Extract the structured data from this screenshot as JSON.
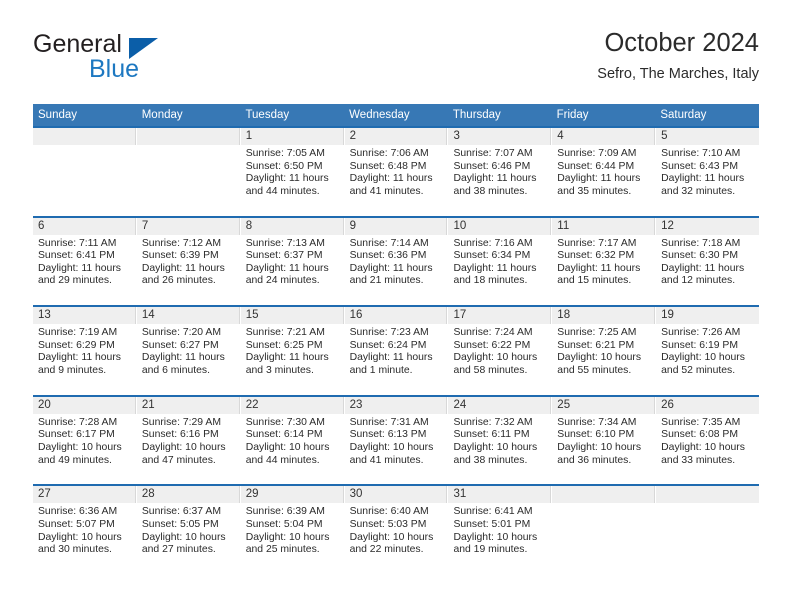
{
  "brand": {
    "name_part1": "General",
    "name_part2": "Blue",
    "triangle_color": "#0b5ea8",
    "blue_color": "#1d78c1"
  },
  "header": {
    "title": "October 2024",
    "subtitle": "Sefro, The Marches, Italy"
  },
  "theme": {
    "header_band": "#3778b5",
    "row_divider": "#1f6bb0",
    "date_strip": "#efefef"
  },
  "weekdays": [
    "Sunday",
    "Monday",
    "Tuesday",
    "Wednesday",
    "Thursday",
    "Friday",
    "Saturday"
  ],
  "weeks": [
    [
      {
        "day": "",
        "sunrise": "",
        "sunset": "",
        "daylight1": "",
        "daylight2": ""
      },
      {
        "day": "",
        "sunrise": "",
        "sunset": "",
        "daylight1": "",
        "daylight2": ""
      },
      {
        "day": "1",
        "sunrise": "Sunrise: 7:05 AM",
        "sunset": "Sunset: 6:50 PM",
        "daylight1": "Daylight: 11 hours",
        "daylight2": "and 44 minutes."
      },
      {
        "day": "2",
        "sunrise": "Sunrise: 7:06 AM",
        "sunset": "Sunset: 6:48 PM",
        "daylight1": "Daylight: 11 hours",
        "daylight2": "and 41 minutes."
      },
      {
        "day": "3",
        "sunrise": "Sunrise: 7:07 AM",
        "sunset": "Sunset: 6:46 PM",
        "daylight1": "Daylight: 11 hours",
        "daylight2": "and 38 minutes."
      },
      {
        "day": "4",
        "sunrise": "Sunrise: 7:09 AM",
        "sunset": "Sunset: 6:44 PM",
        "daylight1": "Daylight: 11 hours",
        "daylight2": "and 35 minutes."
      },
      {
        "day": "5",
        "sunrise": "Sunrise: 7:10 AM",
        "sunset": "Sunset: 6:43 PM",
        "daylight1": "Daylight: 11 hours",
        "daylight2": "and 32 minutes."
      }
    ],
    [
      {
        "day": "6",
        "sunrise": "Sunrise: 7:11 AM",
        "sunset": "Sunset: 6:41 PM",
        "daylight1": "Daylight: 11 hours",
        "daylight2": "and 29 minutes."
      },
      {
        "day": "7",
        "sunrise": "Sunrise: 7:12 AM",
        "sunset": "Sunset: 6:39 PM",
        "daylight1": "Daylight: 11 hours",
        "daylight2": "and 26 minutes."
      },
      {
        "day": "8",
        "sunrise": "Sunrise: 7:13 AM",
        "sunset": "Sunset: 6:37 PM",
        "daylight1": "Daylight: 11 hours",
        "daylight2": "and 24 minutes."
      },
      {
        "day": "9",
        "sunrise": "Sunrise: 7:14 AM",
        "sunset": "Sunset: 6:36 PM",
        "daylight1": "Daylight: 11 hours",
        "daylight2": "and 21 minutes."
      },
      {
        "day": "10",
        "sunrise": "Sunrise: 7:16 AM",
        "sunset": "Sunset: 6:34 PM",
        "daylight1": "Daylight: 11 hours",
        "daylight2": "and 18 minutes."
      },
      {
        "day": "11",
        "sunrise": "Sunrise: 7:17 AM",
        "sunset": "Sunset: 6:32 PM",
        "daylight1": "Daylight: 11 hours",
        "daylight2": "and 15 minutes."
      },
      {
        "day": "12",
        "sunrise": "Sunrise: 7:18 AM",
        "sunset": "Sunset: 6:30 PM",
        "daylight1": "Daylight: 11 hours",
        "daylight2": "and 12 minutes."
      }
    ],
    [
      {
        "day": "13",
        "sunrise": "Sunrise: 7:19 AM",
        "sunset": "Sunset: 6:29 PM",
        "daylight1": "Daylight: 11 hours",
        "daylight2": "and 9 minutes."
      },
      {
        "day": "14",
        "sunrise": "Sunrise: 7:20 AM",
        "sunset": "Sunset: 6:27 PM",
        "daylight1": "Daylight: 11 hours",
        "daylight2": "and 6 minutes."
      },
      {
        "day": "15",
        "sunrise": "Sunrise: 7:21 AM",
        "sunset": "Sunset: 6:25 PM",
        "daylight1": "Daylight: 11 hours",
        "daylight2": "and 3 minutes."
      },
      {
        "day": "16",
        "sunrise": "Sunrise: 7:23 AM",
        "sunset": "Sunset: 6:24 PM",
        "daylight1": "Daylight: 11 hours",
        "daylight2": "and 1 minute."
      },
      {
        "day": "17",
        "sunrise": "Sunrise: 7:24 AM",
        "sunset": "Sunset: 6:22 PM",
        "daylight1": "Daylight: 10 hours",
        "daylight2": "and 58 minutes."
      },
      {
        "day": "18",
        "sunrise": "Sunrise: 7:25 AM",
        "sunset": "Sunset: 6:21 PM",
        "daylight1": "Daylight: 10 hours",
        "daylight2": "and 55 minutes."
      },
      {
        "day": "19",
        "sunrise": "Sunrise: 7:26 AM",
        "sunset": "Sunset: 6:19 PM",
        "daylight1": "Daylight: 10 hours",
        "daylight2": "and 52 minutes."
      }
    ],
    [
      {
        "day": "20",
        "sunrise": "Sunrise: 7:28 AM",
        "sunset": "Sunset: 6:17 PM",
        "daylight1": "Daylight: 10 hours",
        "daylight2": "and 49 minutes."
      },
      {
        "day": "21",
        "sunrise": "Sunrise: 7:29 AM",
        "sunset": "Sunset: 6:16 PM",
        "daylight1": "Daylight: 10 hours",
        "daylight2": "and 47 minutes."
      },
      {
        "day": "22",
        "sunrise": "Sunrise: 7:30 AM",
        "sunset": "Sunset: 6:14 PM",
        "daylight1": "Daylight: 10 hours",
        "daylight2": "and 44 minutes."
      },
      {
        "day": "23",
        "sunrise": "Sunrise: 7:31 AM",
        "sunset": "Sunset: 6:13 PM",
        "daylight1": "Daylight: 10 hours",
        "daylight2": "and 41 minutes."
      },
      {
        "day": "24",
        "sunrise": "Sunrise: 7:32 AM",
        "sunset": "Sunset: 6:11 PM",
        "daylight1": "Daylight: 10 hours",
        "daylight2": "and 38 minutes."
      },
      {
        "day": "25",
        "sunrise": "Sunrise: 7:34 AM",
        "sunset": "Sunset: 6:10 PM",
        "daylight1": "Daylight: 10 hours",
        "daylight2": "and 36 minutes."
      },
      {
        "day": "26",
        "sunrise": "Sunrise: 7:35 AM",
        "sunset": "Sunset: 6:08 PM",
        "daylight1": "Daylight: 10 hours",
        "daylight2": "and 33 minutes."
      }
    ],
    [
      {
        "day": "27",
        "sunrise": "Sunrise: 6:36 AM",
        "sunset": "Sunset: 5:07 PM",
        "daylight1": "Daylight: 10 hours",
        "daylight2": "and 30 minutes."
      },
      {
        "day": "28",
        "sunrise": "Sunrise: 6:37 AM",
        "sunset": "Sunset: 5:05 PM",
        "daylight1": "Daylight: 10 hours",
        "daylight2": "and 27 minutes."
      },
      {
        "day": "29",
        "sunrise": "Sunrise: 6:39 AM",
        "sunset": "Sunset: 5:04 PM",
        "daylight1": "Daylight: 10 hours",
        "daylight2": "and 25 minutes."
      },
      {
        "day": "30",
        "sunrise": "Sunrise: 6:40 AM",
        "sunset": "Sunset: 5:03 PM",
        "daylight1": "Daylight: 10 hours",
        "daylight2": "and 22 minutes."
      },
      {
        "day": "31",
        "sunrise": "Sunrise: 6:41 AM",
        "sunset": "Sunset: 5:01 PM",
        "daylight1": "Daylight: 10 hours",
        "daylight2": "and 19 minutes."
      },
      {
        "day": "",
        "sunrise": "",
        "sunset": "",
        "daylight1": "",
        "daylight2": ""
      },
      {
        "day": "",
        "sunrise": "",
        "sunset": "",
        "daylight1": "",
        "daylight2": ""
      }
    ]
  ]
}
